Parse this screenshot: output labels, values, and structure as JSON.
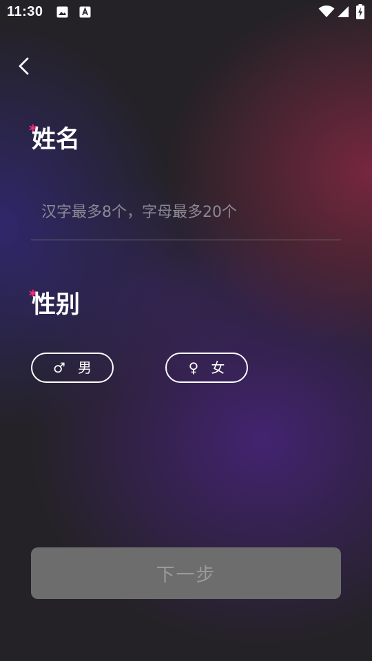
{
  "status_bar": {
    "time": "11:30",
    "icons": [
      "image-icon",
      "a-icon",
      "wifi-icon",
      "signal-icon",
      "battery-charging-icon"
    ]
  },
  "header": {
    "back_icon": "chevron-left-icon"
  },
  "name_section": {
    "required_mark": "*",
    "title": "姓名",
    "input_value": "",
    "placeholder": "汉字最多8个，字母最多20个"
  },
  "gender_section": {
    "required_mark": "*",
    "title": "性别",
    "options": [
      {
        "symbol": "♂",
        "label": "男"
      },
      {
        "symbol": "♀",
        "label": "女"
      }
    ]
  },
  "next_button": {
    "label": "下一步"
  },
  "colors": {
    "required": "#ff2d78",
    "button_disabled_bg": "#6d6d6d",
    "button_disabled_text": "#9a9a9a"
  }
}
